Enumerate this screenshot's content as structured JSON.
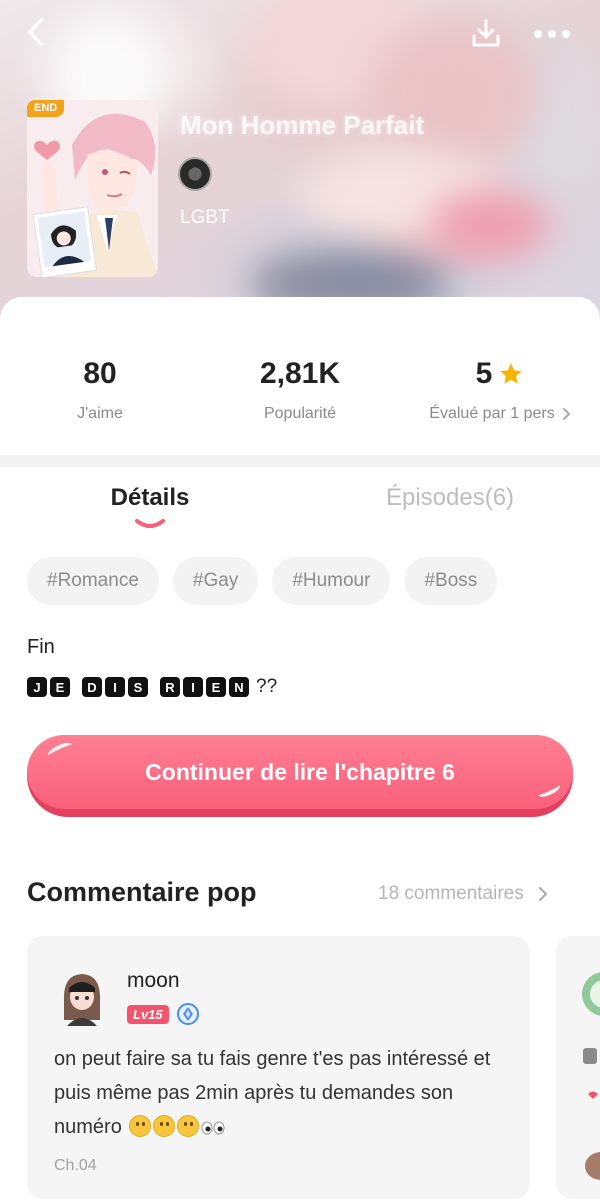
{
  "header": {
    "title": "Mon Homme Parfait",
    "genre": "LGBT",
    "end_badge": "END"
  },
  "stats": [
    {
      "value": "80",
      "label": "J'aime"
    },
    {
      "value": "2,81K",
      "label": "Popularité"
    },
    {
      "value": "5",
      "label": "Évalué par 1 pers",
      "icon": "star-icon"
    }
  ],
  "tabs": [
    {
      "label": "Détails",
      "active": true
    },
    {
      "label": "Épisodes(6)",
      "active": false
    }
  ],
  "tags": [
    "#Romance",
    "#Gay",
    "#Humour",
    "#Boss"
  ],
  "description": {
    "line1": "Fin",
    "boxed_words": [
      "JE",
      "DIS",
      "RIEN"
    ],
    "suffix": "??"
  },
  "cta": {
    "label": "Continuer de lire l'chapitre 6"
  },
  "comments_section": {
    "title": "Commentaire pop",
    "count_link": "18 commentaires",
    "comments": [
      {
        "user": "moon",
        "level": "Lv15",
        "text": "on peut faire sa tu fais genre t'es pas intéressé et puis même pas 2min après tu demandes son numéro",
        "chapter": "Ch.04"
      }
    ]
  },
  "colors": {
    "accent": "#f9607a",
    "star": "#f7b500",
    "end_badge": "#f4a21b",
    "level_badge": "#f2546d"
  }
}
